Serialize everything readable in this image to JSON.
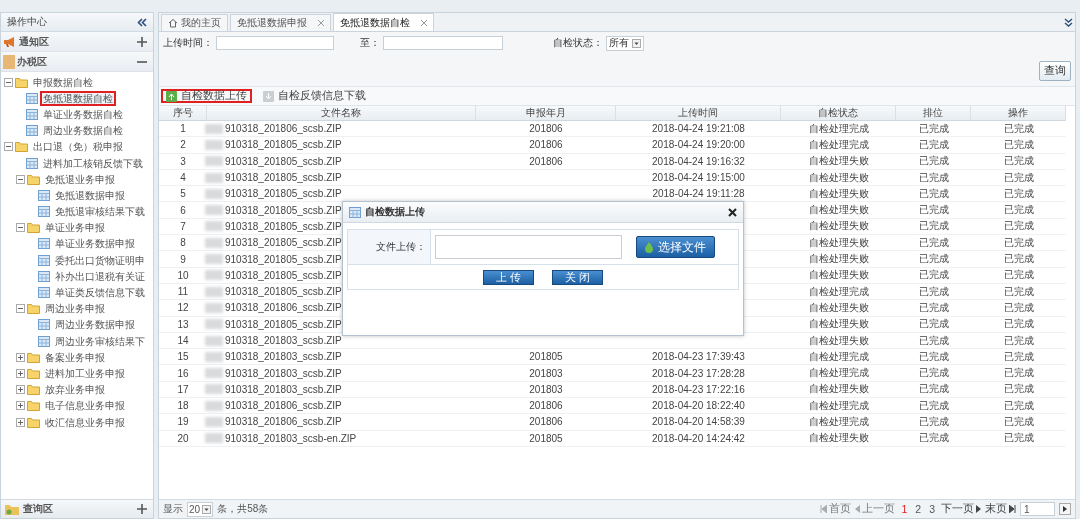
{
  "sidebar": {
    "title": "操作中心",
    "sections": [
      {
        "label": "通知区",
        "expanded": false
      },
      {
        "label": "办税区",
        "expanded": true
      }
    ],
    "tree": [
      {
        "label": "申报数据自检",
        "kind": "folder",
        "expanded": true,
        "selected": false,
        "children": [
          {
            "label": "免抵退数据自检",
            "kind": "page",
            "selected": true
          },
          {
            "label": "单证业务数据自检",
            "kind": "page",
            "selected": false
          },
          {
            "label": "周边业务数据自检",
            "kind": "page",
            "selected": false
          }
        ]
      },
      {
        "label": "出口退（免）税申报",
        "kind": "folder",
        "expanded": true,
        "selected": false,
        "children": [
          {
            "label": "进料加工核销反馈下载",
            "kind": "page",
            "selected": false
          },
          {
            "label": "免抵退业务申报",
            "kind": "folder",
            "expanded": true,
            "selected": false,
            "children": [
              {
                "label": "免抵退数据申报",
                "kind": "page",
                "selected": false
              },
              {
                "label": "免抵退审核结果下载",
                "kind": "page",
                "selected": false
              }
            ]
          },
          {
            "label": "单证业务申报",
            "kind": "folder",
            "expanded": true,
            "selected": false,
            "children": [
              {
                "label": "单证业务数据申报",
                "kind": "page",
                "selected": false
              },
              {
                "label": "委托出口货物证明申",
                "kind": "page",
                "selected": false
              },
              {
                "label": "补办出口退税有关证",
                "kind": "page",
                "selected": false
              },
              {
                "label": "单证类反馈信息下载",
                "kind": "page",
                "selected": false
              }
            ]
          },
          {
            "label": "周边业务申报",
            "kind": "folder",
            "expanded": true,
            "selected": false,
            "children": [
              {
                "label": "周边业务数据申报",
                "kind": "page",
                "selected": false
              },
              {
                "label": "周边业务审核结果下",
                "kind": "page",
                "selected": false
              }
            ]
          },
          {
            "label": "备案业务申报",
            "kind": "folder",
            "expanded": false,
            "selected": false
          },
          {
            "label": "进料加工业务申报",
            "kind": "folder",
            "expanded": false,
            "selected": false
          },
          {
            "label": "放弃业务申报",
            "kind": "folder",
            "expanded": false,
            "selected": false
          },
          {
            "label": "电子信息业务申报",
            "kind": "folder",
            "expanded": false,
            "selected": false
          },
          {
            "label": "收汇信息业务申报",
            "kind": "folder",
            "expanded": false,
            "selected": false
          }
        ]
      }
    ],
    "footer": {
      "label": "查询区",
      "expanded": false
    }
  },
  "tabs": [
    {
      "label": "我的主页",
      "kind": "home",
      "selected": false
    },
    {
      "label": "免抵退数据申报",
      "kind": "closable",
      "selected": false
    },
    {
      "label": "免抵退数据自检",
      "kind": "closable",
      "selected": true
    }
  ],
  "filters": {
    "from_label": "上传时间：",
    "to_label": "至：",
    "status_label": "自检状态：",
    "status_value": "所有",
    "query_button": "查询"
  },
  "toolbar": [
    {
      "label": "自检数据上传",
      "kind": "upload",
      "highlighted": true
    },
    {
      "label": "自检反馈信息下载",
      "kind": "download",
      "highlighted": false
    }
  ],
  "table": {
    "columns": [
      "序号",
      "文件名称",
      "申报年月",
      "上传时间",
      "自检状态",
      "排位",
      "操作"
    ],
    "rows": [
      {
        "no": "1",
        "file": "910318_201806_scsb.ZIP",
        "month": "201806",
        "time": "2018-04-24 19:21:08",
        "status": "自检处理完成",
        "rank": "已完成",
        "action": "已完成"
      },
      {
        "no": "2",
        "file": "910318_201805_scsb.ZIP",
        "month": "201806",
        "time": "2018-04-24 19:20:00",
        "status": "自检处理完成",
        "rank": "已完成",
        "action": "已完成"
      },
      {
        "no": "3",
        "file": "910318_201805_scsb.ZIP",
        "month": "201806",
        "time": "2018-04-24 19:16:32",
        "status": "自检处理失败",
        "rank": "已完成",
        "action": "已完成"
      },
      {
        "no": "4",
        "file": "910318_201805_scsb.ZIP",
        "time": "2018-04-24 19:15:00",
        "status": "自检处理失败",
        "rank": "已完成",
        "action": "已完成"
      },
      {
        "no": "5",
        "file": "910318_201805_scsb.ZIP",
        "time": "2018-04-24 19:11:28",
        "status": "自检处理失败",
        "rank": "已完成",
        "action": "已完成"
      },
      {
        "no": "6",
        "file": "910318_201805_scsb.ZIP",
        "status": "自检处理失败",
        "rank": "已完成",
        "action": "已完成"
      },
      {
        "no": "7",
        "file": "910318_201805_scsb.ZIP",
        "status": "自检处理失败",
        "rank": "已完成",
        "action": "已完成"
      },
      {
        "no": "8",
        "file": "910318_201805_scsb.ZIP",
        "status": "自检处理失败",
        "rank": "已完成",
        "action": "已完成"
      },
      {
        "no": "9",
        "file": "910318_201805_scsb.ZIP",
        "status": "自检处理失败",
        "rank": "已完成",
        "action": "已完成"
      },
      {
        "no": "10",
        "file": "910318_201805_scsb.ZIP",
        "status": "自检处理失败",
        "rank": "已完成",
        "action": "已完成"
      },
      {
        "no": "11",
        "file": "910318_201805_scsb.ZIP",
        "status": "自检处理完成",
        "rank": "已完成",
        "action": "已完成"
      },
      {
        "no": "12",
        "file": "910318_201806_scsb.ZIP",
        "status": "自检处理失败",
        "rank": "已完成",
        "action": "已完成"
      },
      {
        "no": "13",
        "file": "910318_201805_scsb.ZIP",
        "status": "自检处理失败",
        "rank": "已完成",
        "action": "已完成"
      },
      {
        "no": "14",
        "file": "910318_201803_scsb.ZIP",
        "status": "自检处理失败",
        "rank": "已完成",
        "action": "已完成"
      },
      {
        "no": "15",
        "file": "910318_201803_scsb.ZIP",
        "month": "201805",
        "time": "2018-04-23 17:39:43",
        "status": "自检处理完成",
        "rank": "已完成",
        "action": "已完成"
      },
      {
        "no": "16",
        "file": "910318_201803_scsb.ZIP",
        "month": "201803",
        "time": "2018-04-23 17:28:28",
        "status": "自检处理完成",
        "rank": "已完成",
        "action": "已完成"
      },
      {
        "no": "17",
        "file": "910318_201803_scsb.ZIP",
        "month": "201803",
        "time": "2018-04-23 17:22:16",
        "status": "自检处理失败",
        "rank": "已完成",
        "action": "已完成"
      },
      {
        "no": "18",
        "file": "910318_201806_scsb.ZIP",
        "month": "201806",
        "time": "2018-04-20 18:22:40",
        "status": "自检处理完成",
        "rank": "已完成",
        "action": "已完成"
      },
      {
        "no": "19",
        "file": "910318_201806_scsb.ZIP",
        "month": "201806",
        "time": "2018-04-20 14:58:39",
        "status": "自检处理完成",
        "rank": "已完成",
        "action": "已完成"
      },
      {
        "no": "20",
        "file": "910318_201803_scsb-en.ZIP",
        "month": "201805",
        "time": "2018-04-20 14:24:42",
        "status": "自检处理失败",
        "rank": "已完成",
        "action": "已完成"
      }
    ]
  },
  "pager": {
    "show_label": "显示",
    "page_size": "20",
    "count_text": "条，共58条",
    "first": "首页",
    "prev": "上一页",
    "pages": [
      {
        "label": "1",
        "selected": true
      },
      {
        "label": "2",
        "selected": false
      },
      {
        "label": "3",
        "selected": false
      }
    ],
    "next": "下一页",
    "last": "末页",
    "page_input": "1"
  },
  "dialog": {
    "title": "自检数据上传",
    "field_label": "文件上传：",
    "choose_button": "选择文件",
    "buttons": [
      "上 传",
      "关 闭"
    ]
  }
}
